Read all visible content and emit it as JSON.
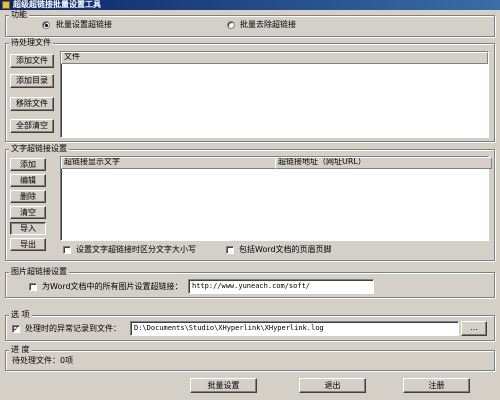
{
  "window": {
    "title": "超级超链接批量设置工具",
    "icon": "app-icon"
  },
  "function_group": {
    "legend": "功能",
    "options": [
      {
        "label": "批量设置超链接",
        "selected": true
      },
      {
        "label": "批量去除超链接",
        "selected": false
      }
    ]
  },
  "files_group": {
    "legend": "待处理文件",
    "buttons": {
      "add_file": "添加文件",
      "add_dir": "添加目录",
      "remove_file": "移除文件",
      "clear_all": "全部清空"
    },
    "list_header": "文件"
  },
  "text_link_group": {
    "legend": "文字超链接设置",
    "buttons": {
      "add": "添加",
      "edit": "编辑",
      "delete": "删除",
      "clear": "清空",
      "import": "导入",
      "export": "导出"
    },
    "columns": [
      "超链接显示文字",
      "超链接地址（网址URL）"
    ],
    "case_sensitive": {
      "label": "设置文字超链接时区分文字大小写",
      "checked": false
    },
    "include_header_footer": {
      "label": "包括Word文档的页眉页脚",
      "checked": false
    }
  },
  "image_link_group": {
    "legend": "图片超链接设置",
    "checkbox_label": "为Word文档中的所有图片设置超链接：",
    "checked": false,
    "url_value": "http://www.yuneach.com/soft/"
  },
  "options_group": {
    "legend": "选   项",
    "log_label": "处理时的异常记录到文件：",
    "log_checked": true,
    "log_path": "D:\\Documents\\Studio\\XHyperlink\\XHyperlink.log",
    "browse_label": "..."
  },
  "progress_group": {
    "legend": "进   度",
    "status": "待处理文件：0项"
  },
  "footer": {
    "batch_set": "批量设置",
    "exit": "退出",
    "register": "注册"
  },
  "icons": {
    "check_mark": "✓"
  }
}
